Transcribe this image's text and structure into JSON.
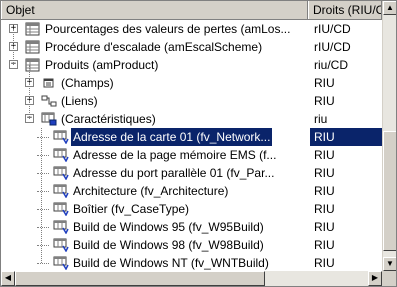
{
  "columns": {
    "object": "Objet",
    "rights": "Droits (RIU/C"
  },
  "rows": [
    {
      "label": "Pourcentages des valeurs de pertes (amLos...",
      "rights": "rIU/CD",
      "icon": "table-icon",
      "toggle": "+"
    },
    {
      "label": "Procédure d'escalade (amEscalScheme)",
      "rights": "rIU/CD",
      "icon": "table-icon",
      "toggle": "+"
    },
    {
      "label": "Produits (amProduct)",
      "rights": "riu/CD",
      "icon": "table-icon",
      "toggle": "−"
    },
    {
      "label": " (Champs)",
      "rights": "RIU",
      "icon": "fields-icon",
      "toggle": "+"
    },
    {
      "label": "(Liens)",
      "rights": "RIU",
      "icon": "links-icon",
      "toggle": "+"
    },
    {
      "label": "(Caractéristiques)",
      "rights": "riu",
      "icon": "features-icon",
      "toggle": "−"
    },
    {
      "label": "Adresse de la carte 01 (fv_Network...",
      "rights": "RIU",
      "icon": "feature-item-icon",
      "selected": true
    },
    {
      "label": "Adresse de la page mémoire EMS (f...",
      "rights": "RIU",
      "icon": "feature-item-icon"
    },
    {
      "label": "Adresse du port parallèle 01 (fv_Par...",
      "rights": "RIU",
      "icon": "feature-item-icon"
    },
    {
      "label": "Architecture (fv_Architecture)",
      "rights": "RIU",
      "icon": "feature-item-icon"
    },
    {
      "label": "Boîtier (fv_CaseType)",
      "rights": "RIU",
      "icon": "feature-item-icon"
    },
    {
      "label": "Build de Windows 95 (fv_W95Build)",
      "rights": "RIU",
      "icon": "feature-item-icon"
    },
    {
      "label": "Build de Windows 98 (fv_W98Build)",
      "rights": "RIU",
      "icon": "feature-item-icon"
    },
    {
      "label": "Build de Windows NT (fv_WNTBuild)",
      "rights": "RIU",
      "icon": "feature-item-icon"
    }
  ],
  "colors": {
    "selection": "#0a246a",
    "chrome": "#d4d0c8"
  }
}
